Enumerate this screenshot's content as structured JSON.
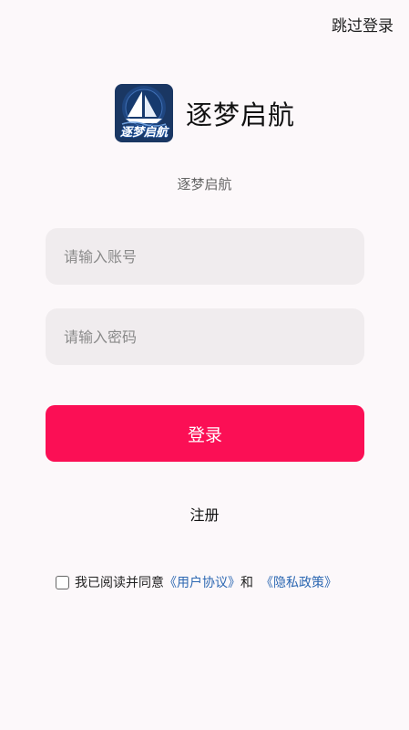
{
  "header": {
    "skip_login": "跳过登录"
  },
  "brand": {
    "logo_icon": "sailboat-logo-icon",
    "logo_text": "逐梦启航",
    "app_name": "逐梦启航",
    "subtitle": "逐梦启航"
  },
  "form": {
    "account_placeholder": "请输入账号",
    "account_value": "",
    "password_placeholder": "请输入密码",
    "password_value": "",
    "login_label": "登录",
    "register_label": "注册"
  },
  "agreement": {
    "checked": false,
    "prefix": "我已阅读并同意",
    "user_agreement": "《用户协议》",
    "and": "和",
    "privacy_policy": "《隐私政策》"
  },
  "colors": {
    "background": "#fcf8fa",
    "primary": "#fb0f55",
    "input_bg": "#f0ecee",
    "link": "#2d68b2"
  }
}
